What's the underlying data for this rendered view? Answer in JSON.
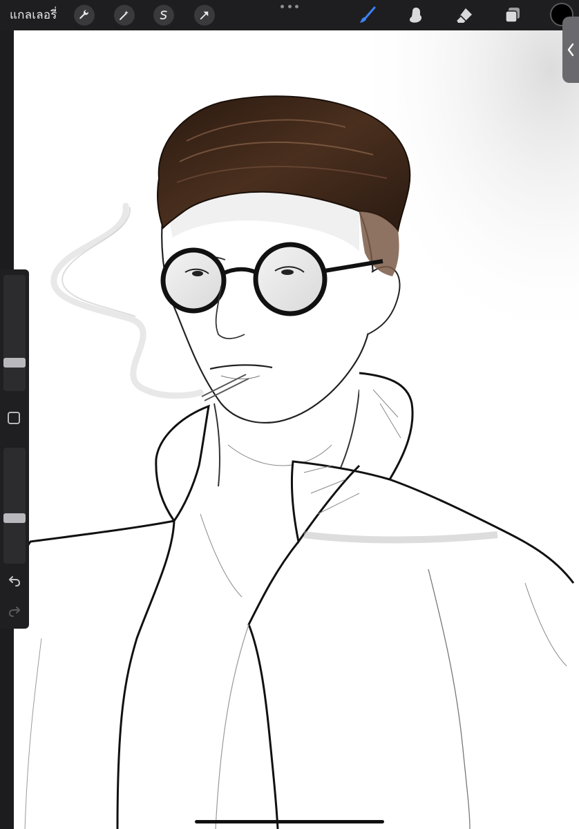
{
  "toolbar": {
    "gallery_label": "แกลเลอรี่",
    "left_tools": [
      {
        "name": "wrench-icon"
      },
      {
        "name": "magic-wand-icon"
      },
      {
        "name": "selection-icon"
      },
      {
        "name": "transform-arrow-icon"
      }
    ],
    "right_tools": [
      {
        "name": "brush-icon",
        "active": true
      },
      {
        "name": "smudge-icon",
        "active": false
      },
      {
        "name": "eraser-icon",
        "active": false
      },
      {
        "name": "layers-icon",
        "active": false
      }
    ],
    "current_color": "#000000",
    "active_tool_color": "#3a82f7"
  },
  "sidebar": {
    "brush_size_level": 0.22,
    "brush_opacity_level": 0.38
  },
  "canvas": {
    "background_color": "#ffffff",
    "hair_color": "#3b2518"
  }
}
